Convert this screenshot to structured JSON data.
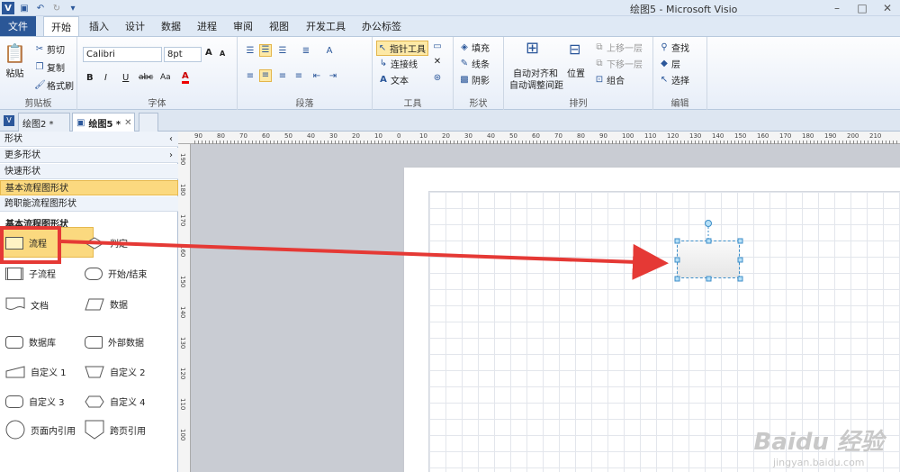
{
  "window": {
    "title": "绘图5 - Microsoft Visio"
  },
  "ribbon_tabs": [
    {
      "label": "文件"
    },
    {
      "label": "开始"
    },
    {
      "label": "插入"
    },
    {
      "label": "设计"
    },
    {
      "label": "数据"
    },
    {
      "label": "进程"
    },
    {
      "label": "审阅"
    },
    {
      "label": "视图"
    },
    {
      "label": "开发工具"
    },
    {
      "label": "办公标签"
    }
  ],
  "clipboard": {
    "paste": "粘贴",
    "cut": "剪切",
    "copy": "复制",
    "format_painter": "格式刷",
    "label": "剪贴板"
  },
  "font": {
    "name": "Calibri",
    "size": "8pt",
    "label": "字体",
    "bold": "B",
    "italic": "I",
    "underline": "U",
    "abc": "abc",
    "grow": "A",
    "shrink": "A",
    "color_a": "A",
    "aa": "Aa"
  },
  "paragraph": {
    "label": "段落"
  },
  "tools": {
    "pointer": "指针工具",
    "connector": "连接线",
    "text": "文本",
    "label": "工具"
  },
  "shape_group": {
    "fill": "填充",
    "line": "线条",
    "shadow": "阴影",
    "label": "形状"
  },
  "arrange": {
    "auto_align": "自动对齐和",
    "auto_space": "自动调整间距",
    "position": "位置",
    "bring_forward": "上移一层",
    "send_backward": "下移一层",
    "group": "组合",
    "label": "排列"
  },
  "editing": {
    "find": "查找",
    "layer": "层",
    "select": "选择",
    "label": "编辑"
  },
  "doc_tabs": [
    {
      "label": "绘图2 *"
    },
    {
      "label": "绘图5 *"
    }
  ],
  "shapes_pane": {
    "title": "形状",
    "more": "更多形状",
    "quick": "快速形状",
    "basic_flow": "基本流程图形状",
    "cross_func": "跨职能流程图形状",
    "section_title": "基本流程图形状",
    "items": [
      {
        "label": "流程"
      },
      {
        "label": "判定"
      },
      {
        "label": "子流程"
      },
      {
        "label": "开始/结束"
      },
      {
        "label": "文档"
      },
      {
        "label": "数据"
      },
      {
        "label": "数据库"
      },
      {
        "label": "外部数据"
      },
      {
        "label": "自定义 1"
      },
      {
        "label": "自定义 2"
      },
      {
        "label": "自定义 3"
      },
      {
        "label": "自定义 4"
      },
      {
        "label": "页面内引用"
      },
      {
        "label": "跨页引用"
      }
    ]
  },
  "ruler": {
    "h_ticks": [
      "90",
      "80",
      "70",
      "60",
      "50",
      "40",
      "30",
      "20",
      "10",
      "0",
      "10",
      "20",
      "30",
      "40",
      "50",
      "60",
      "70",
      "80",
      "90",
      "100",
      "110",
      "120",
      "130",
      "140",
      "150",
      "160",
      "170",
      "180",
      "190",
      "200",
      "210"
    ],
    "v_ticks": [
      "190",
      "180",
      "170",
      "160",
      "150",
      "140",
      "130",
      "120",
      "110",
      "100"
    ]
  },
  "watermark": {
    "logo": "Baidu 经验",
    "url": "jingyan.baidu.com"
  },
  "colors": {
    "accent": "#2b5797",
    "highlight": "#fbd97f",
    "annotation_red": "#e53935",
    "shape_outline": "#3c8dc8"
  }
}
